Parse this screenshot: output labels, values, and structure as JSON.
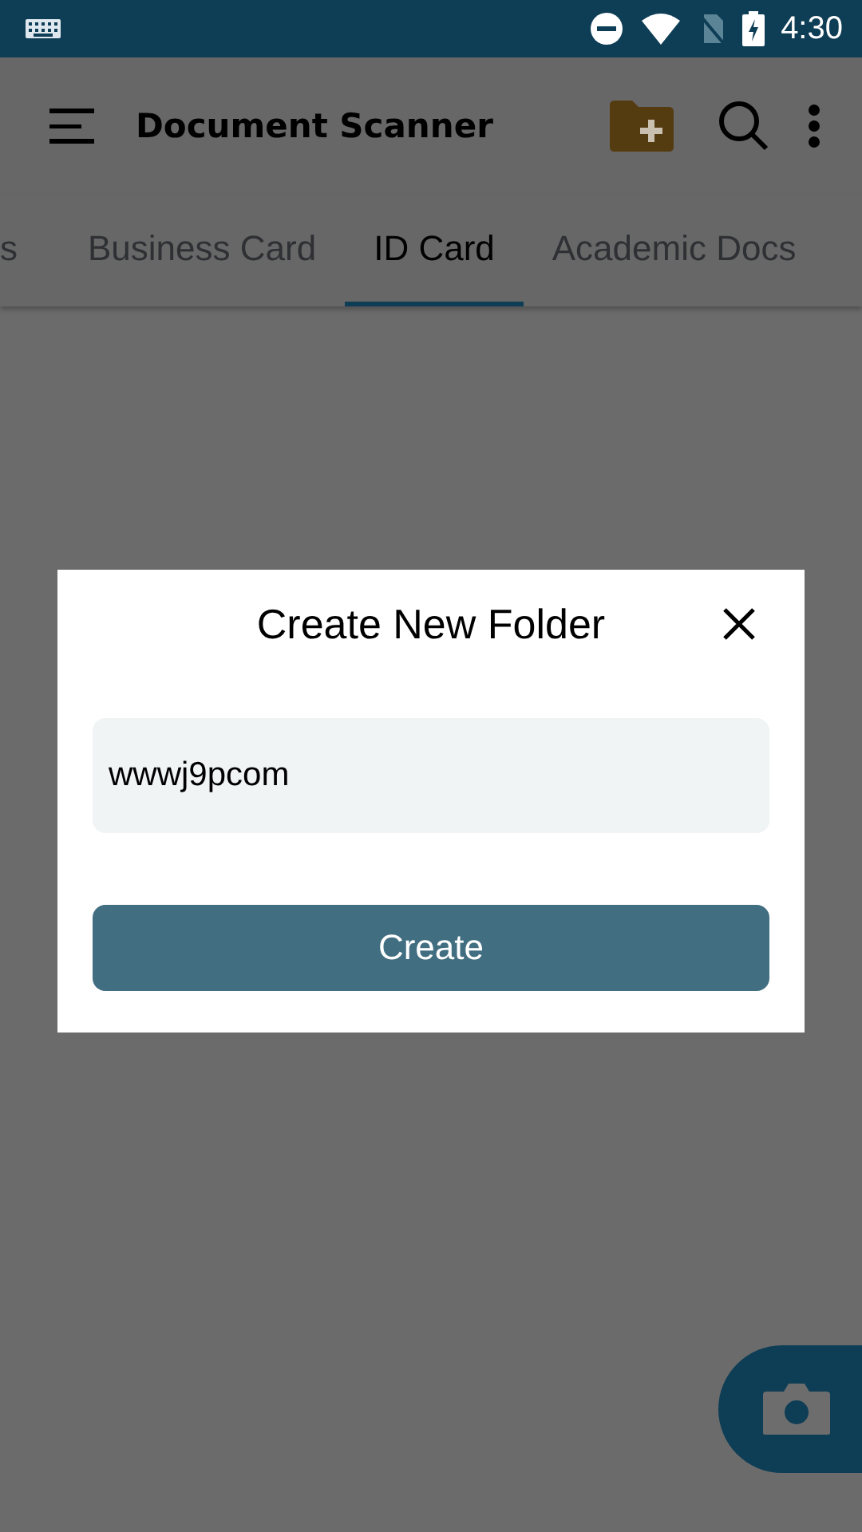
{
  "status_bar": {
    "time": "4:30"
  },
  "app_bar": {
    "title": "Document Scanner"
  },
  "tabs": [
    {
      "label": "s",
      "selected": false
    },
    {
      "label": "Business Card",
      "selected": false
    },
    {
      "label": "ID Card",
      "selected": true
    },
    {
      "label": "Academic Docs",
      "selected": false
    }
  ],
  "dialog": {
    "title": "Create New Folder",
    "field": {
      "value": "wwwj9pcom"
    },
    "button": "Create"
  }
}
